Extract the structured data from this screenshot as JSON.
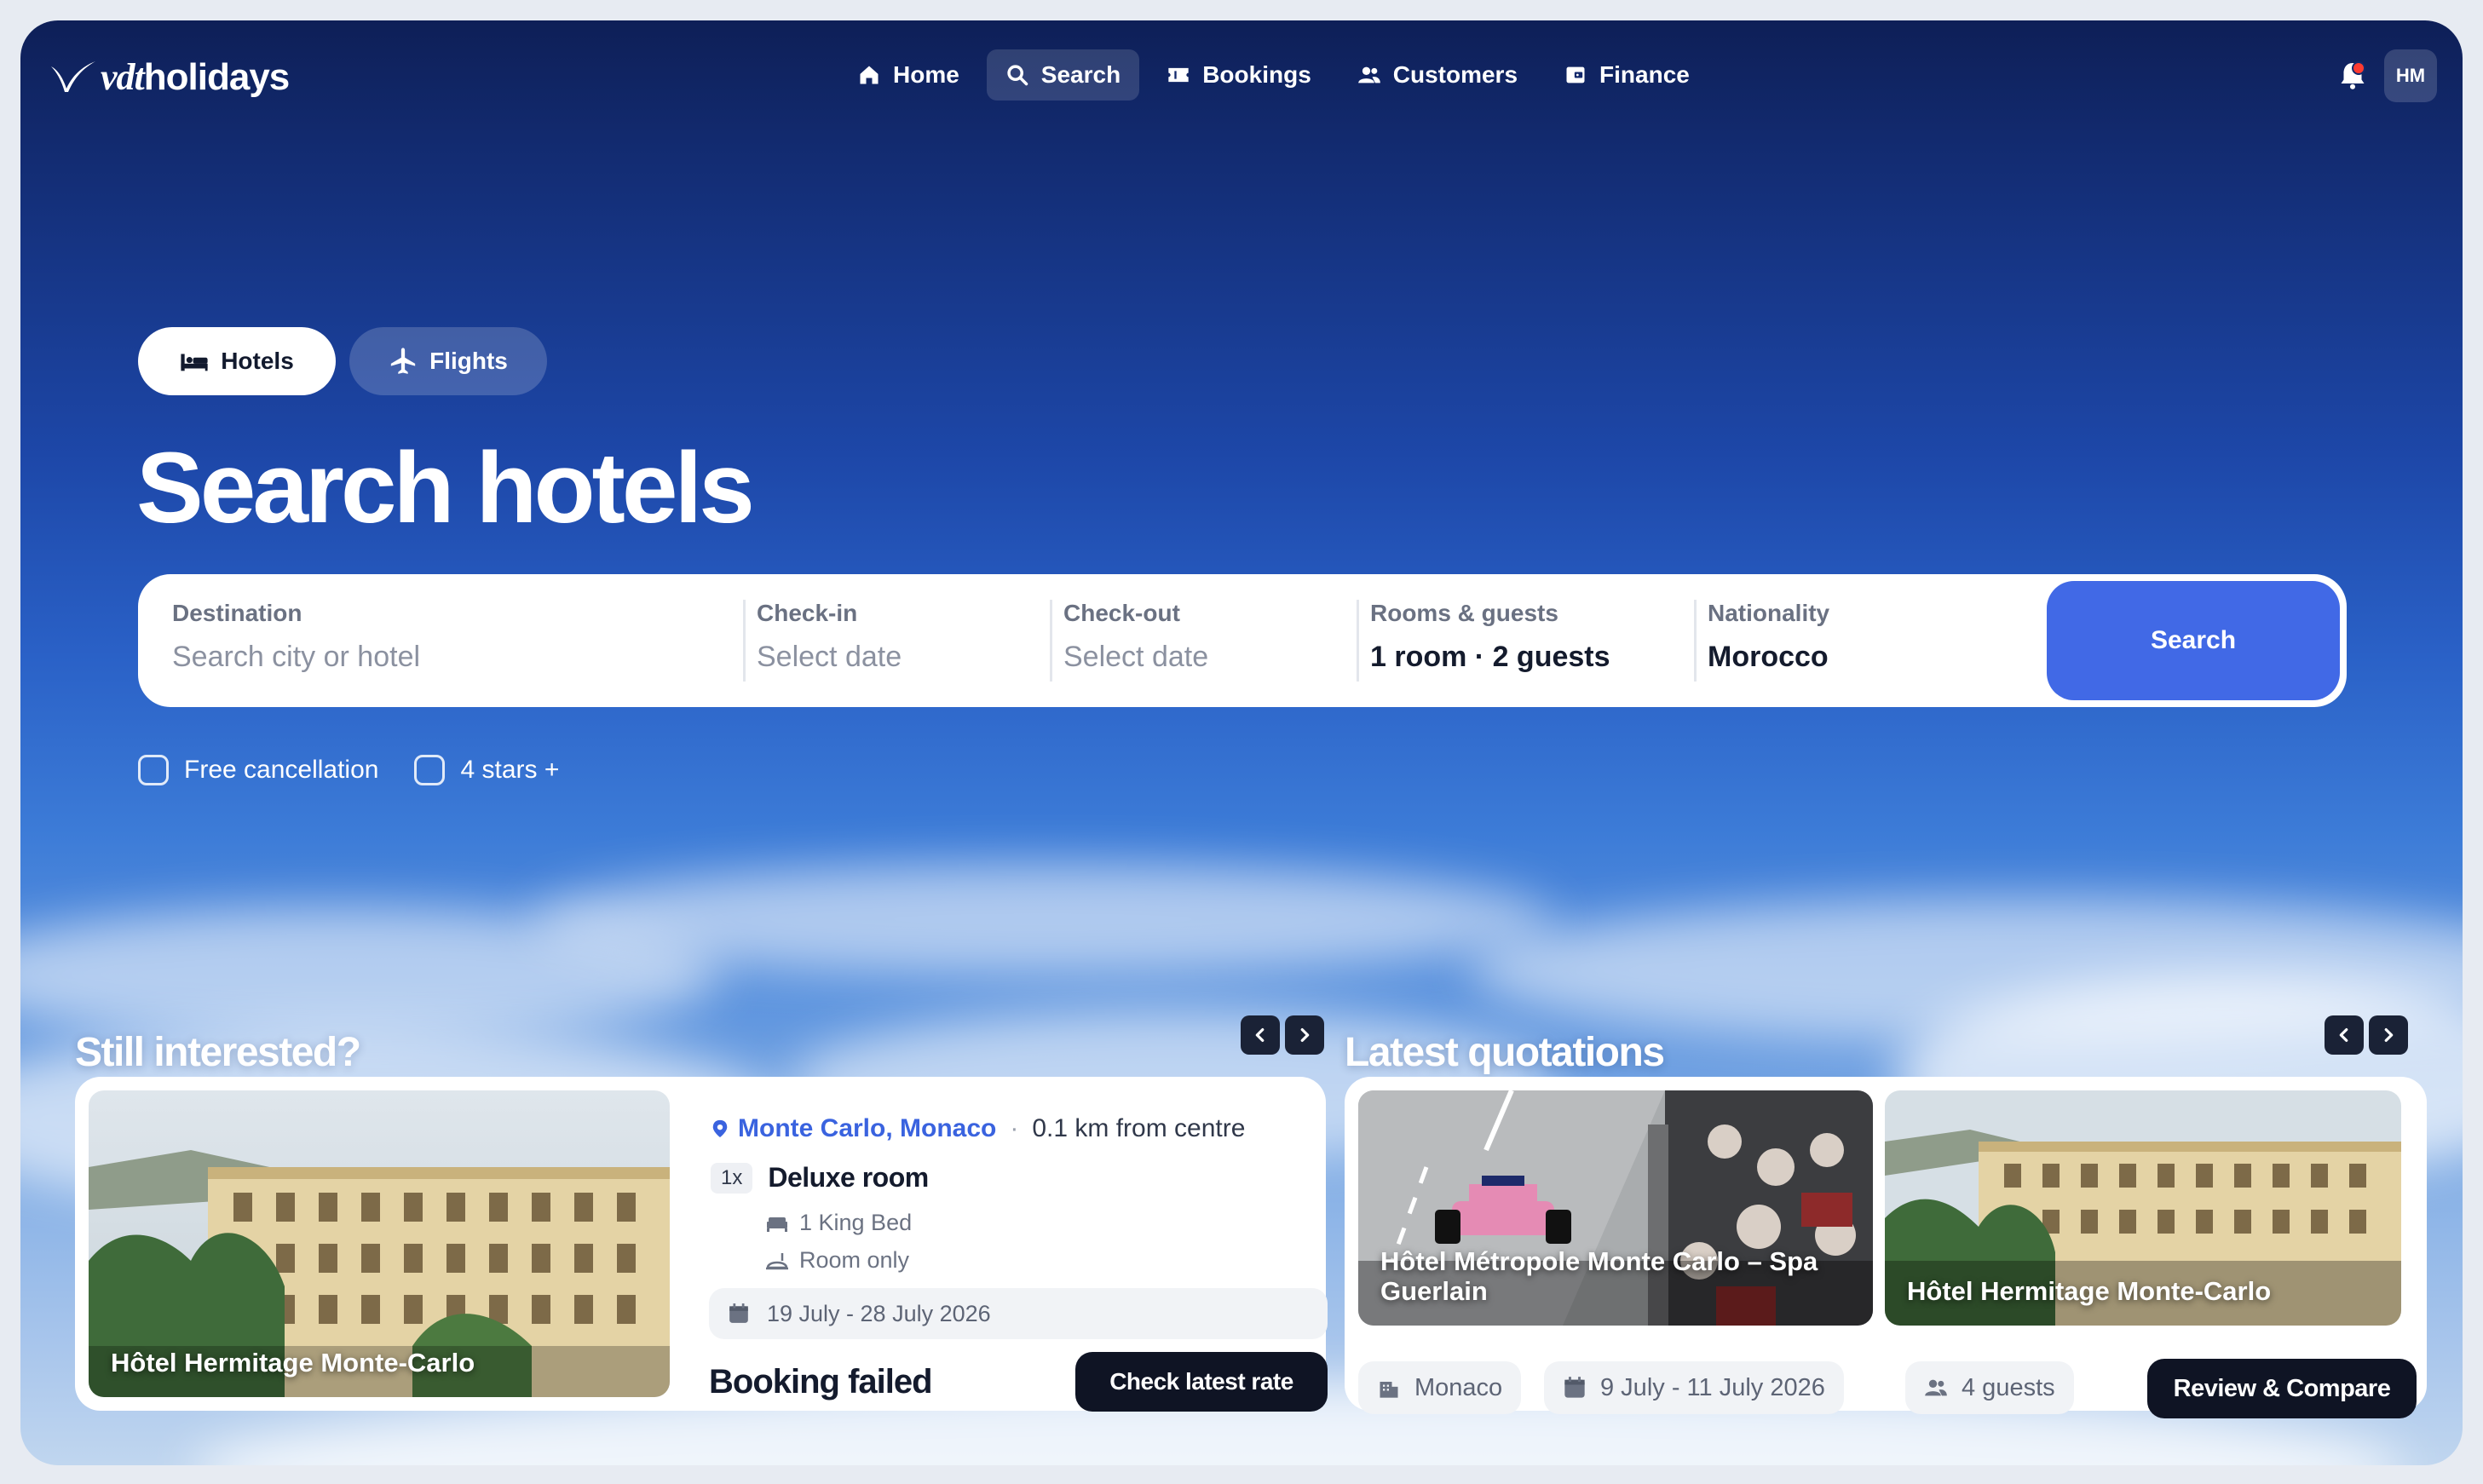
{
  "brand": {
    "logo_italic": "vdt",
    "logo_rest": "holidays"
  },
  "nav": {
    "items": [
      {
        "label": "Home",
        "icon": "home-icon"
      },
      {
        "label": "Search",
        "icon": "search-icon",
        "active": true
      },
      {
        "label": "Bookings",
        "icon": "ticket-icon"
      },
      {
        "label": "Customers",
        "icon": "users-icon"
      },
      {
        "label": "Finance",
        "icon": "wallet-icon"
      }
    ],
    "notifications_icon": "bell-icon",
    "avatar_initials": "HM"
  },
  "tabs": [
    {
      "label": "Hotels",
      "icon": "bed-icon",
      "active": true
    },
    {
      "label": "Flights",
      "icon": "plane-icon",
      "active": false
    }
  ],
  "hero": {
    "title": "Search hotels"
  },
  "search": {
    "destination": {
      "label": "Destination",
      "placeholder": "Search city or hotel"
    },
    "checkin": {
      "label": "Check-in",
      "placeholder": "Select date"
    },
    "checkout": {
      "label": "Check-out",
      "placeholder": "Select date"
    },
    "rooms": {
      "label": "Rooms & guests",
      "value": "1 room · 2 guests"
    },
    "nationality": {
      "label": "Nationality",
      "value": "Morocco"
    },
    "button": "Search"
  },
  "filters": [
    {
      "label": "Free cancellation",
      "checked": false
    },
    {
      "label": "4 stars +",
      "checked": false
    }
  ],
  "interested": {
    "title": "Still interested?",
    "card": {
      "hotel": "Hôtel Hermitage Monte-Carlo",
      "location": "Monte Carlo, Monaco",
      "distance": "0.1 km from centre",
      "quantity": "1x",
      "room": "Deluxe room",
      "bed": "1 King Bed",
      "board": "Room only",
      "dates": "19 July  -  28 July 2026",
      "status": "Booking failed",
      "action": "Check latest rate"
    }
  },
  "quotations": {
    "title": "Latest quotations",
    "card": {
      "hotels": [
        "Hôtel Métropole Monte Carlo – Spa Guerlain",
        "Hôtel Hermitage Monte-Carlo"
      ],
      "destination": "Monaco",
      "dates": "9 July  -  11 July 2026",
      "guests": "4 guests",
      "action": "Review & Compare"
    }
  },
  "colors": {
    "accent": "#4169e6",
    "dark_button": "#0f1424",
    "link": "#3a63df"
  }
}
